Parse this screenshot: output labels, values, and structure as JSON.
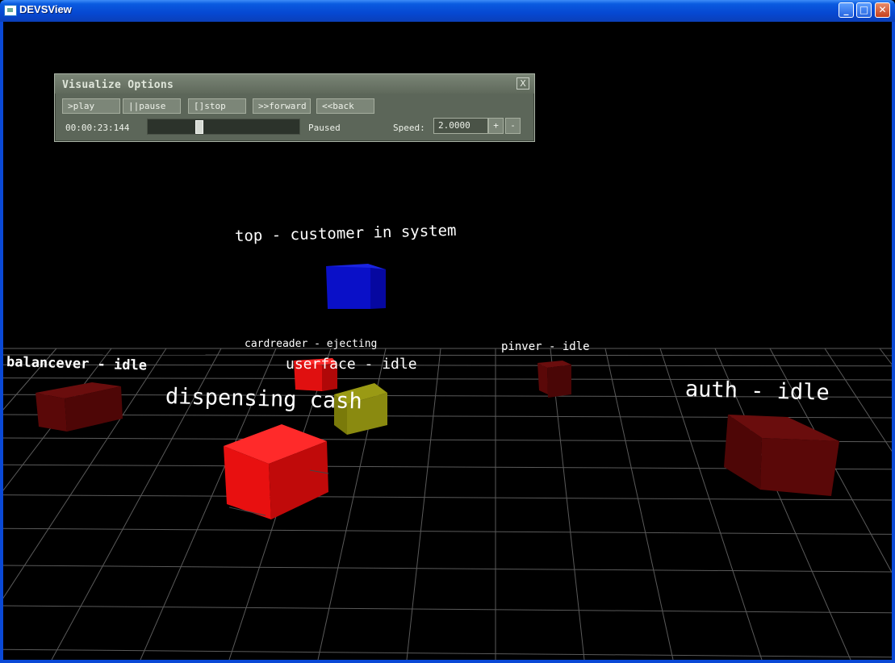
{
  "window": {
    "title": "DEVSView",
    "minimize_glyph": "_",
    "maximize_glyph": "□",
    "close_glyph": "✕"
  },
  "panel": {
    "title": "Visualize Options",
    "close_glyph": "X",
    "buttons": [
      ">play",
      "||pause",
      "[]stop",
      ">>forward",
      "<<back"
    ],
    "time": "00:00:23:144",
    "progress": 0.33,
    "status": "Paused",
    "speed_label": "Speed:",
    "speed_value": "2.0000",
    "plus": "+",
    "minus": "-"
  },
  "models": [
    {
      "label": "top - customer in system",
      "color": "#0a10c8"
    },
    {
      "label": "cardreader - ejecting",
      "color": "#e01010"
    },
    {
      "label": "userface - idle",
      "color": "#e01010"
    },
    {
      "label": "dispensing cash",
      "color": "#e01010"
    },
    {
      "label": "balancever - idle",
      "color": "#5a0a0a"
    },
    {
      "label": "pinver - idle",
      "color": "#5a0a0a"
    },
    {
      "label": "auth - idle",
      "color": "#5a0a0a"
    },
    {
      "label": "",
      "color": "#8a8a10"
    }
  ]
}
